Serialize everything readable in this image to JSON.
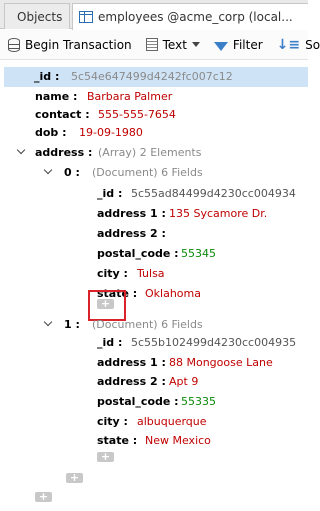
{
  "tabs": [
    {
      "label": "Objects"
    },
    {
      "label": "employees @acme_corp (local..."
    }
  ],
  "toolbar": {
    "begin_transaction": "Begin Transaction",
    "text": "Text",
    "filter": "Filter",
    "sort": "Sort"
  },
  "document": {
    "id_key": "_id :",
    "id_value": "5c54e647499d4242fc007c12",
    "name_key": "name :",
    "name_value": "Barbara Palmer",
    "contact_key": "contact :",
    "contact_value": "555-555-7654",
    "dob_key": "dob :",
    "dob_value": "19-09-1980",
    "address_key": "address :",
    "address_meta": "(Array) 2 Elements",
    "addresses": [
      {
        "index_key": "0 :",
        "meta": "(Document) 6 Fields",
        "id_key": "_id :",
        "id_value": "5c55ad84499d4230cc004934",
        "address1_key": "address 1 :",
        "address1_value": "135 Sycamore Dr.",
        "address2_key": "address 2 :",
        "address2_value": "",
        "postal_key": "postal_code :",
        "postal_value": "55345",
        "city_key": "city :",
        "city_value": "Tulsa",
        "state_key": "state :",
        "state_value": "Oklahoma"
      },
      {
        "index_key": "1 :",
        "meta": "(Document) 6 Fields",
        "id_key": "_id :",
        "id_value": "5c55b102499d4230cc004935",
        "address1_key": "address 1 :",
        "address1_value": "88 Mongoose Lane",
        "address2_key": "address 2 :",
        "address2_value": "Apt 9",
        "postal_key": "postal_code :",
        "postal_value": "55335",
        "city_key": "city :",
        "city_value": "albuquerque",
        "state_key": "state :",
        "state_value": "New Mexico"
      }
    ]
  },
  "add_label": "+"
}
